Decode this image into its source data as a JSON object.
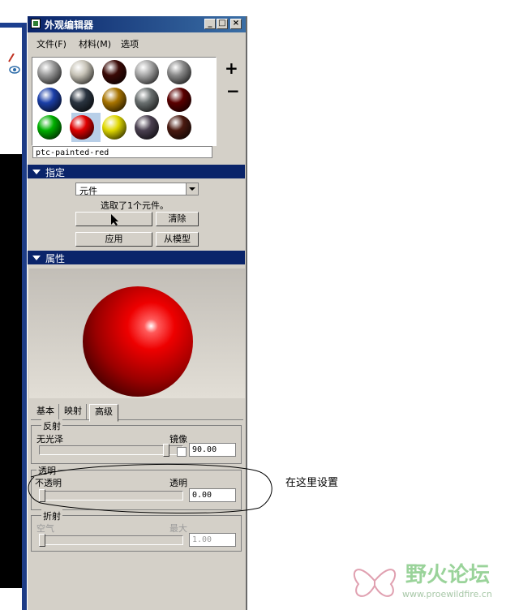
{
  "window": {
    "title": "外观编辑器",
    "menu": [
      "文件(F)",
      "材料(M)",
      "选项"
    ],
    "controls": [
      "_",
      "□",
      "×"
    ]
  },
  "swatches": {
    "add_label": "+",
    "remove_label": "−",
    "selected_name": "ptc-painted-red",
    "colors": [
      "#9a9a9a",
      "#c8c4b8",
      "#3a0a06",
      "#a8a8a8",
      "#8a8a8a",
      "#1b3fa8",
      "#2a3440",
      "#a87400",
      "#6a7070",
      "#5a0000",
      "#00b000",
      "#e00000",
      "#e0d800",
      "#4a4050",
      "#4a1a10"
    ]
  },
  "assign": {
    "header": "指定",
    "dropdown_value": "元件",
    "status": "选取了1个元件。",
    "clear_label": "清除",
    "apply_label": "应用",
    "from_model_label": "从模型"
  },
  "properties": {
    "header": "属性",
    "tabs": [
      "基本",
      "映射",
      "高级"
    ],
    "reflection": {
      "label": "反射",
      "left_label": "无光泽",
      "right_label": "镜像",
      "value": "90.00",
      "fraction": 0.9
    },
    "transparency": {
      "label": "透明",
      "left_label": "不透明",
      "right_label": "透明",
      "value": "0.00",
      "fraction": 0.0
    },
    "refraction": {
      "label": "折射",
      "left_label": "空气",
      "right_label": "最大",
      "value": "1.00",
      "fraction": 0.0
    }
  },
  "annotation": {
    "text": "在这里设置"
  },
  "watermark": {
    "name": "野火论坛",
    "url": "www.proewildfire.cn"
  }
}
